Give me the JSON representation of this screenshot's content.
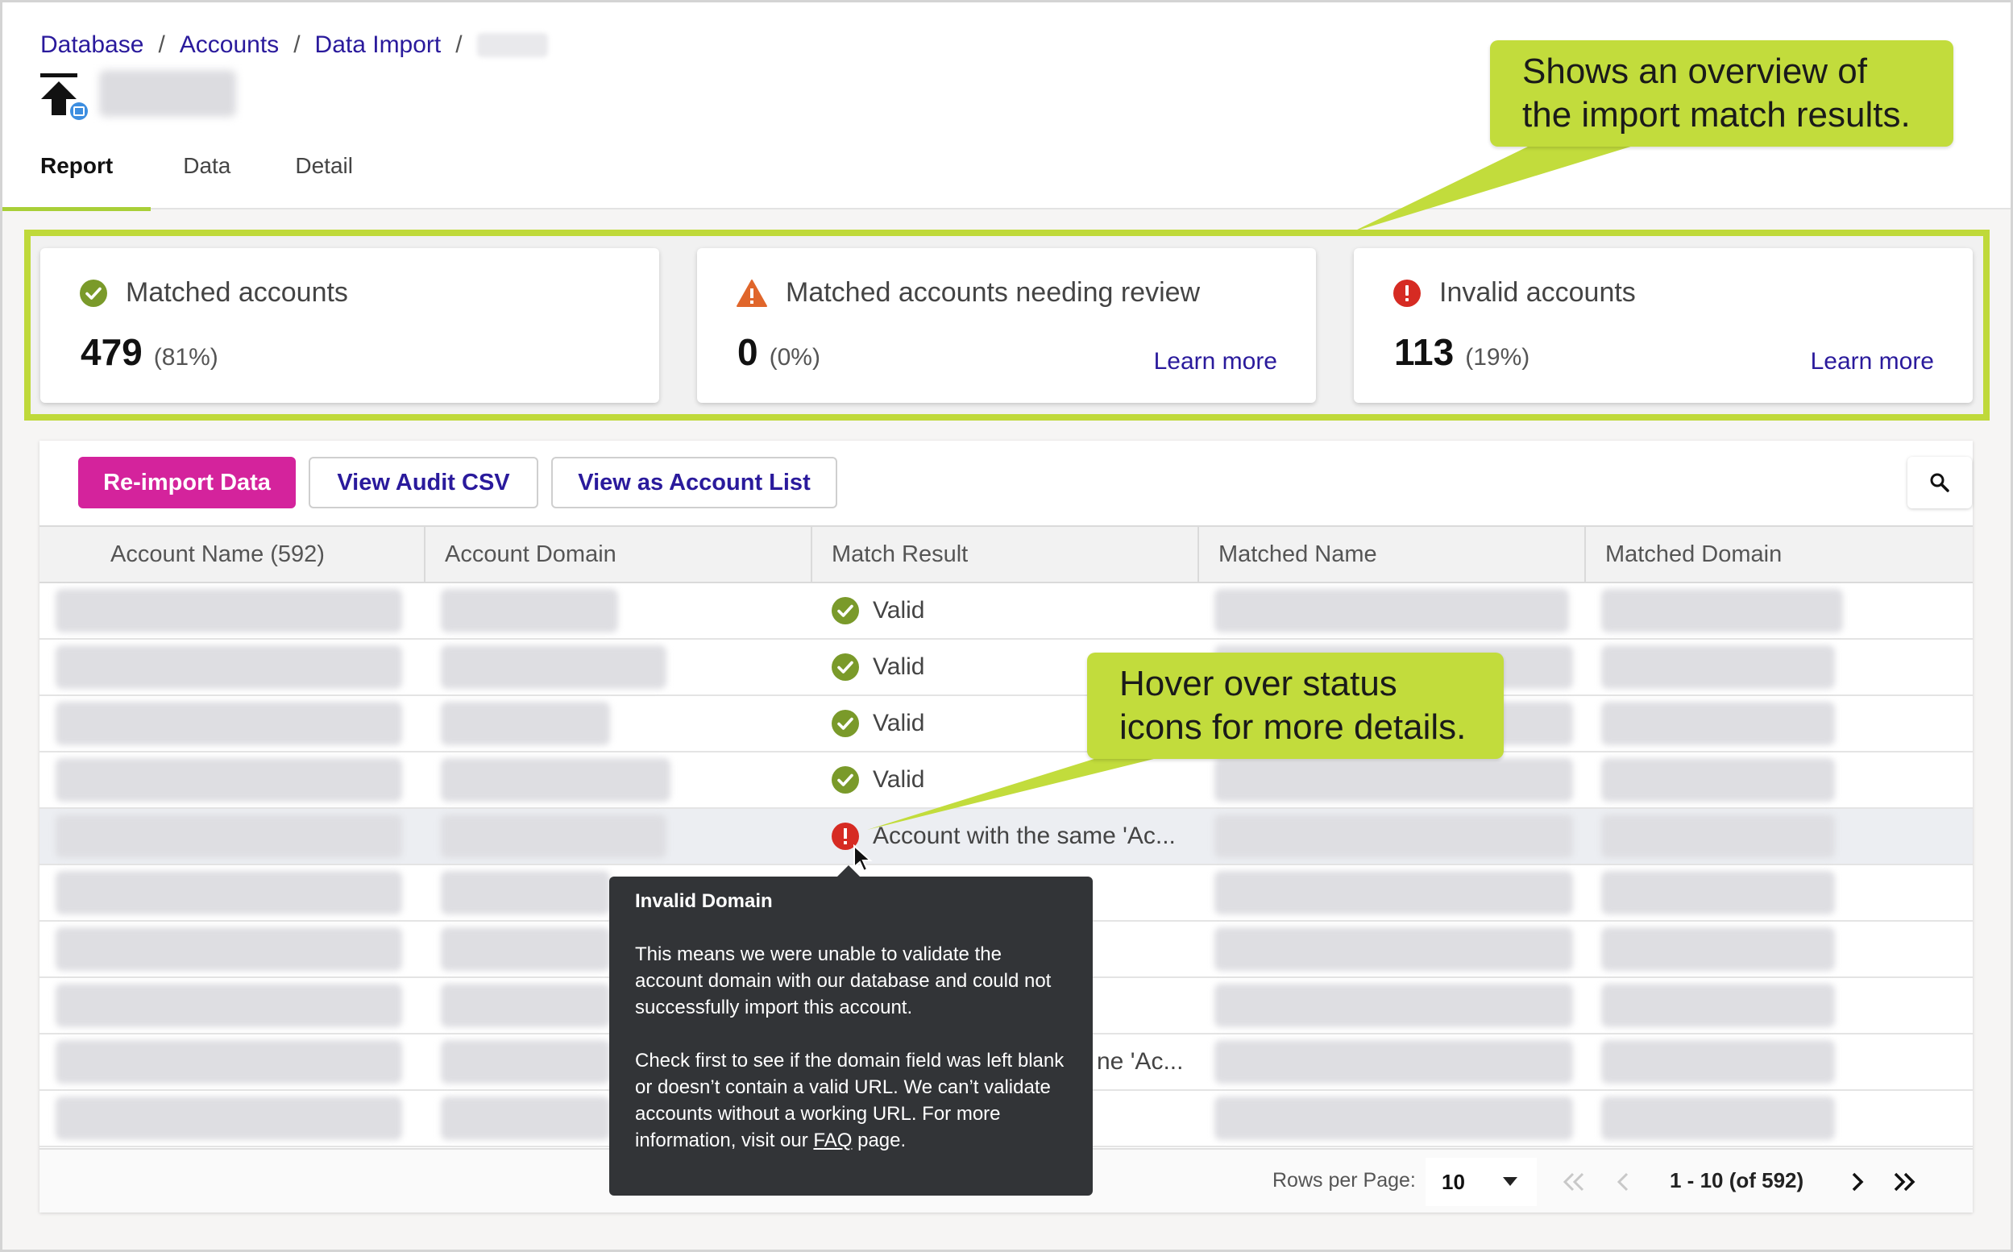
{
  "breadcrumb": {
    "items": [
      "Database",
      "Accounts",
      "Data Import"
    ],
    "separator": "/"
  },
  "tabs": [
    "Report",
    "Data",
    "Detail"
  ],
  "callouts": {
    "overview": [
      "Shows an overview of",
      "the import match results."
    ],
    "hover": [
      "Hover over status",
      "icons for more details."
    ]
  },
  "cards": [
    {
      "title": "Matched accounts",
      "count": "479",
      "percent": "(81%)",
      "icon": "check-circle-icon",
      "link": ""
    },
    {
      "title": "Matched accounts needing review",
      "count": "0",
      "percent": "(0%)",
      "icon": "warning-triangle-icon",
      "link": "Learn more"
    },
    {
      "title": "Invalid accounts",
      "count": "113",
      "percent": "(19%)",
      "icon": "error-circle-icon",
      "link": "Learn more"
    }
  ],
  "toolbar": {
    "reimport": "Re-import Data",
    "audit_csv": "View Audit CSV",
    "account_list": "View as Account List",
    "search_icon": "search-icon"
  },
  "table": {
    "columns": [
      "Account Name (592)",
      "Account Domain",
      "Match Result",
      "Matched Name",
      "Matched Domain"
    ],
    "rows": [
      {
        "status": "valid",
        "result": "Valid"
      },
      {
        "status": "valid",
        "result": "Valid"
      },
      {
        "status": "valid",
        "result": "Valid"
      },
      {
        "status": "valid",
        "result": "Valid"
      },
      {
        "status": "error",
        "result": "Account with the same 'Ac..."
      },
      {
        "status": "hidden",
        "result": ""
      },
      {
        "status": "hidden",
        "result": ""
      },
      {
        "status": "hidden",
        "result": ""
      },
      {
        "status": "hidden",
        "result": "ne 'Ac..."
      },
      {
        "status": "hidden",
        "result": ""
      }
    ]
  },
  "pagination": {
    "rows_per_page_label": "Rows per Page:",
    "rows_per_page": "10",
    "range": "1 - 10 (of 592)"
  },
  "tooltip": {
    "title": "Invalid Domain",
    "para1": "This means we were unable to validate the account domain with our database and could not successfully import this account.",
    "para2_before": "Check first to see if the domain field was left blank or doesn’t contain a valid URL. We can’t validate accounts without a working URL. For more information, visit our",
    "faq_link": "FAQ",
    "para2_after": "page."
  },
  "colors": {
    "accent_green": "#a9cf38",
    "callout_green": "#c2dc3c",
    "link_blue": "#2a1a9c",
    "primary_pink": "#d4239c",
    "valid_green": "#7a9a2a",
    "warning_orange": "#e0662b",
    "error_red": "#d62b23"
  }
}
